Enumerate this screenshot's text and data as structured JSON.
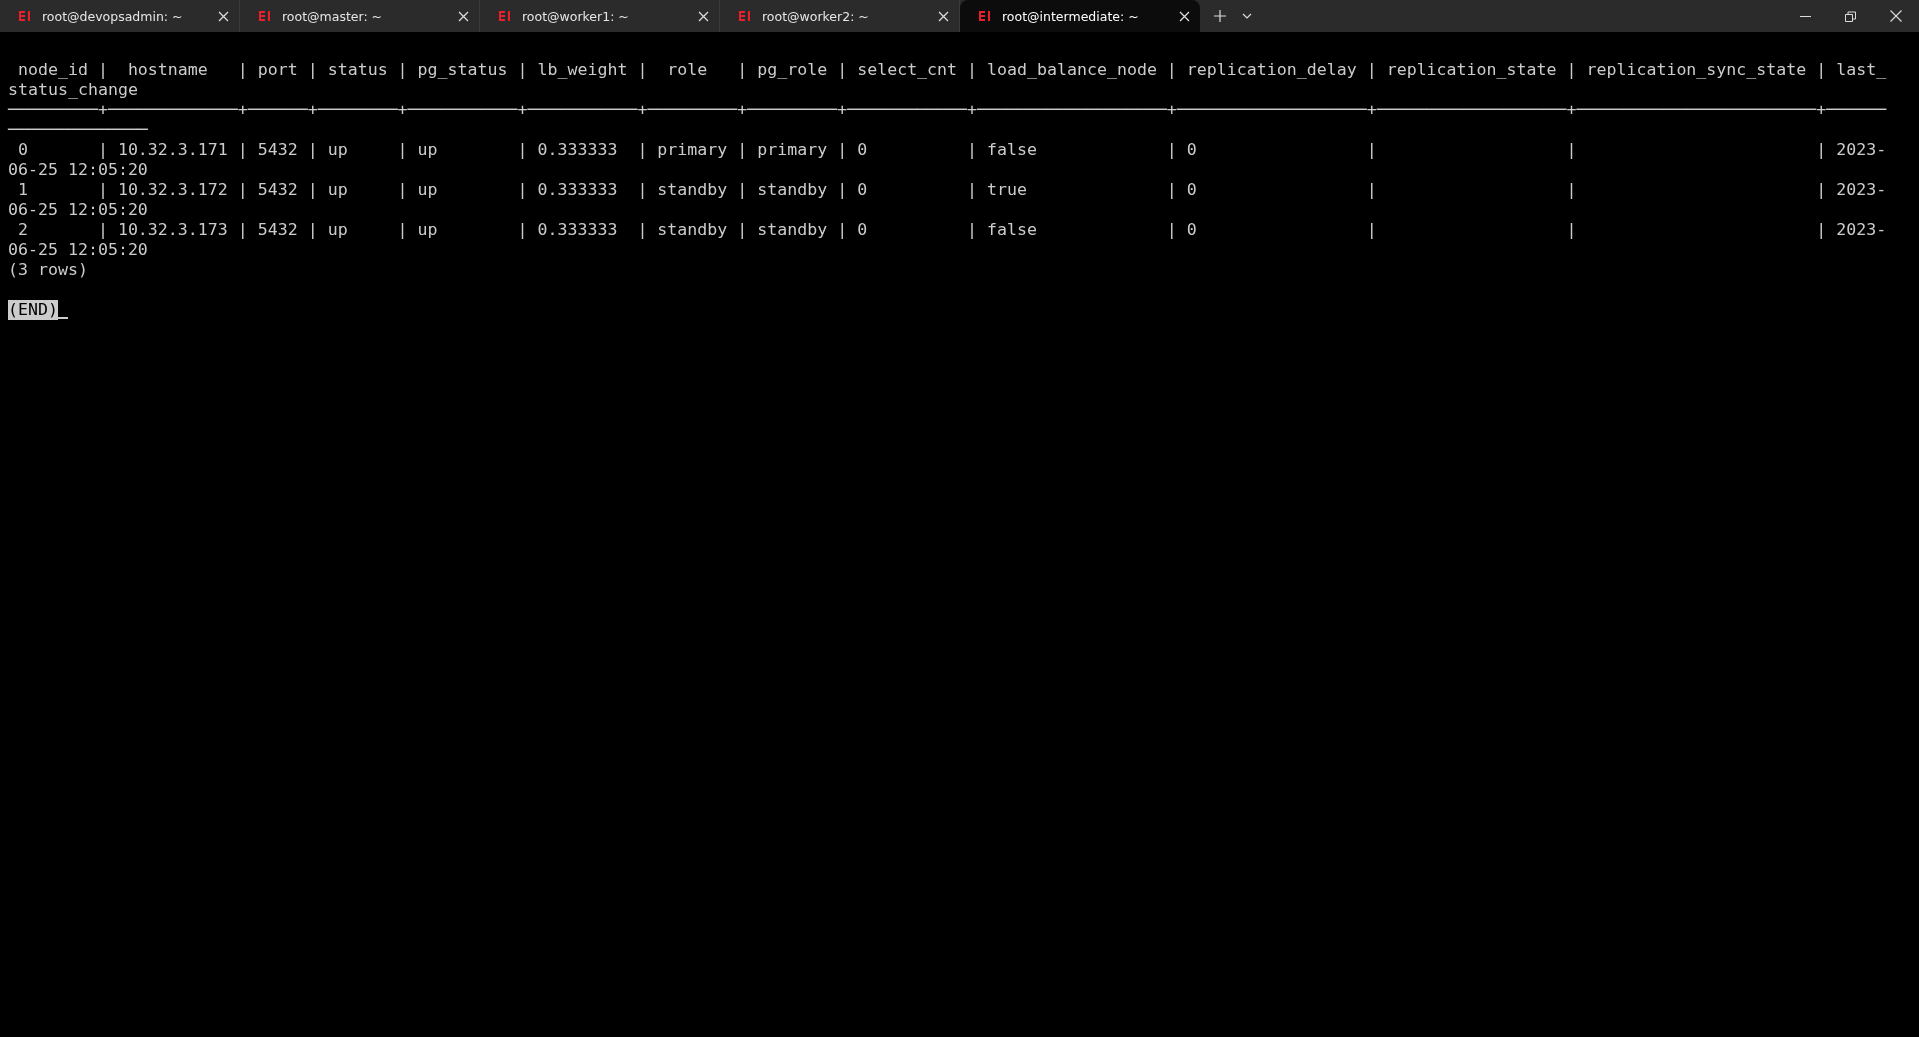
{
  "tabs": [
    {
      "title": "root@devopsadmin: ~",
      "selected": false
    },
    {
      "title": "root@master: ~",
      "selected": false
    },
    {
      "title": "root@worker1: ~",
      "selected": false
    },
    {
      "title": "root@worker2: ~",
      "selected": false
    },
    {
      "title": "root@intermediate: ~",
      "selected": true
    }
  ],
  "terminal": {
    "lines": [
      " node_id |  hostname   | port | status | pg_status | lb_weight |  role   | pg_role | select_cnt | load_balance_node | replication_delay | replication_state | replication_sync_state | last_",
      "status_change",
      "─────────+─────────────+──────+────────+───────────+───────────+─────────+─────────+────────────+───────────────────+───────────────────+───────────────────+────────────────────────+──────",
      "──────────────",
      " 0       | 10.32.3.171 | 5432 | up     | up        | 0.333333  | primary | primary | 0          | false             | 0                 |                   |                        | 2023-",
      "06-25 12:05:20",
      " 1       | 10.32.3.172 | 5432 | up     | up        | 0.333333  | standby | standby | 0          | true              | 0                 |                   |                        | 2023-",
      "06-25 12:05:20",
      " 2       | 10.32.3.173 | 5432 | up     | up        | 0.333333  | standby | standby | 0          | false             | 0                 |                   |                        | 2023-",
      "06-25 12:05:20",
      "(3 rows)"
    ],
    "prompt": "(END)"
  }
}
